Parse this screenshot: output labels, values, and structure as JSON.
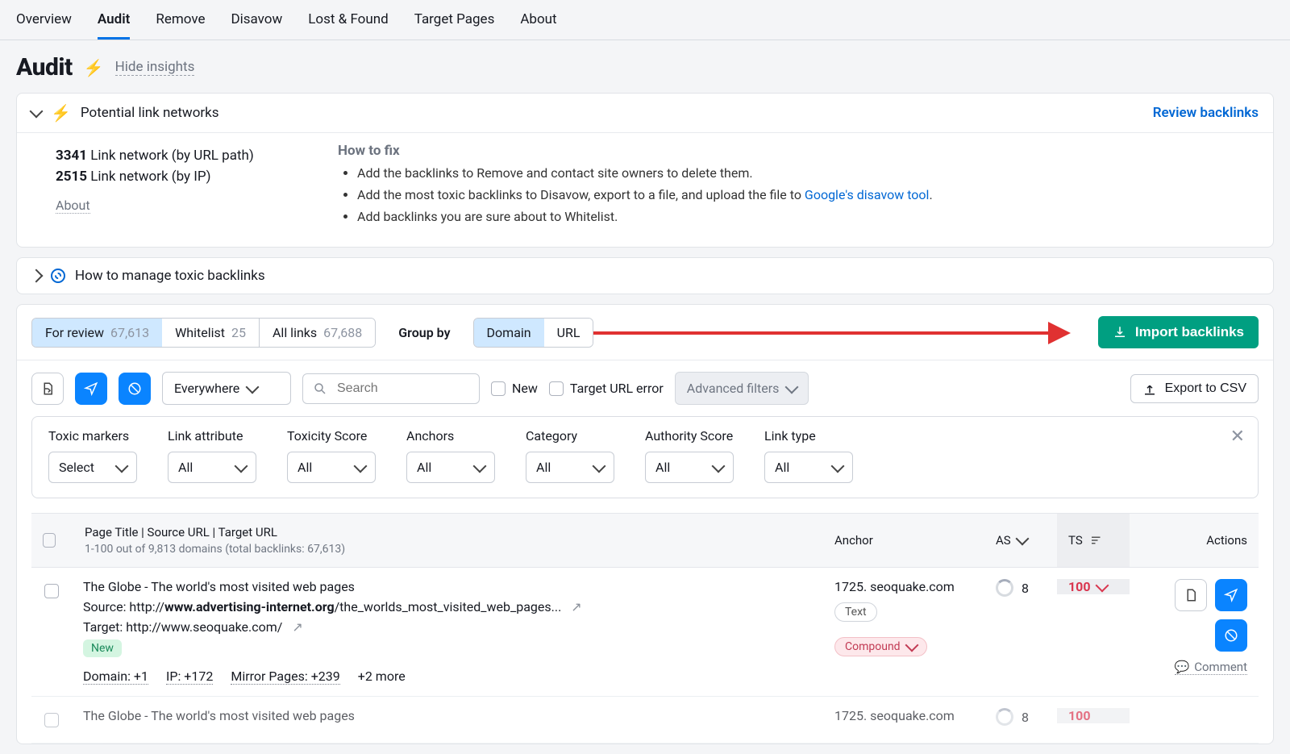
{
  "nav": {
    "tabs": [
      "Overview",
      "Audit",
      "Remove",
      "Disavow",
      "Lost & Found",
      "Target Pages",
      "About"
    ],
    "active": "Audit"
  },
  "page": {
    "title": "Audit",
    "hide_insights": "Hide insights"
  },
  "insight_card": {
    "title": "Potential link networks",
    "review_label": "Review backlinks",
    "about": "About",
    "networks": [
      {
        "count": "3341",
        "label": "Link network (by URL path)"
      },
      {
        "count": "2515",
        "label": "Link network (by IP)"
      }
    ],
    "how_title": "How to fix",
    "how_items": [
      "Add the backlinks to Remove and contact site owners to delete them.",
      "Add the most toxic backlinks to Disavow, export to a file, and upload the file to ",
      "Add backlinks you are sure about to Whitelist."
    ],
    "disavow_link_text": "Google's disavow tool"
  },
  "manage_card": {
    "title": "How to manage toxic backlinks"
  },
  "toolbar": {
    "tabs": [
      {
        "label": "For review",
        "count": "67,613",
        "active": true
      },
      {
        "label": "Whitelist",
        "count": "25",
        "active": false
      },
      {
        "label": "All links",
        "count": "67,688",
        "active": false
      }
    ],
    "group_by": "Group by",
    "group_opts": [
      {
        "label": "Domain",
        "active": true
      },
      {
        "label": "URL",
        "active": false
      }
    ],
    "import_btn": "Import backlinks",
    "everywhere": "Everywhere",
    "search_placeholder": "Search",
    "chk_new": "New",
    "chk_target_err": "Target URL error",
    "adv_filters": "Advanced filters",
    "export_csv": "Export to CSV"
  },
  "filters": {
    "cols": [
      {
        "label": "Toxic markers",
        "value": "Select"
      },
      {
        "label": "Link attribute",
        "value": "All"
      },
      {
        "label": "Toxicity Score",
        "value": "All"
      },
      {
        "label": "Anchors",
        "value": "All"
      },
      {
        "label": "Category",
        "value": "All"
      },
      {
        "label": "Authority Score",
        "value": "All"
      },
      {
        "label": "Link type",
        "value": "All"
      }
    ]
  },
  "table": {
    "head": {
      "main": "Page Title | Source URL | Target URL",
      "sub": "1-100 out of 9,813 domains (total backlinks: 67,613)",
      "anchor": "Anchor",
      "as": "AS",
      "ts": "TS",
      "actions": "Actions"
    },
    "rows": [
      {
        "title": "The Globe - The world's most visited web pages",
        "src_label": "Source: ",
        "src_prefix": "http://",
        "src_bold": "www.advertising-internet.org",
        "src_tail": "/the_worlds_most_visited_web_pages...",
        "tgt_label": "Target: ",
        "tgt": "http://www.seoquake.com/",
        "new": "New",
        "domain": "Domain: +1",
        "ip": "IP: +172",
        "mirror": "Mirror Pages: +239",
        "more": "+2 more",
        "anchor": "1725. seoquake.com",
        "anchor_chip": "Text",
        "compound": "Compound",
        "as": "8",
        "ts": "100",
        "comment": "Comment"
      },
      {
        "title": "The Globe - The world's most visited web pages",
        "anchor": "1725. seoquake.com",
        "as": "8",
        "ts": "100"
      }
    ]
  }
}
